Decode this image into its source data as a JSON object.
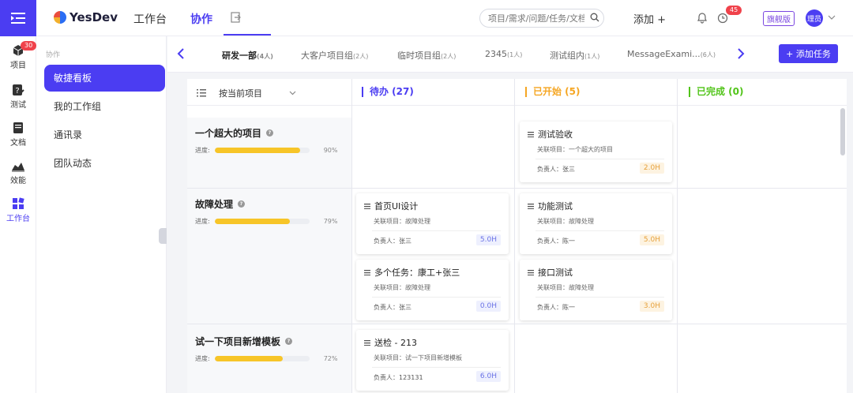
{
  "app": {
    "logo_text": "YesDev"
  },
  "topnav": {
    "items": [
      {
        "label": "工作台"
      },
      {
        "label": "协作"
      }
    ]
  },
  "search": {
    "placeholder": "项目/需求/问题/任务/文档"
  },
  "header": {
    "add_label": "添加 +",
    "notification_badge": "45",
    "plan_tag": "旗舰版",
    "avatar_text": "理员"
  },
  "rail": {
    "items": [
      {
        "label": "项目",
        "badge": "30"
      },
      {
        "label": "测试"
      },
      {
        "label": "文档"
      },
      {
        "label": "效能"
      },
      {
        "label": "工作台"
      }
    ]
  },
  "sidebar": {
    "section": "协作",
    "items": [
      {
        "label": "敏捷看板"
      },
      {
        "label": "我的工作组"
      },
      {
        "label": "通讯录"
      },
      {
        "label": "团队动态"
      }
    ]
  },
  "tabs": [
    {
      "label": "研发一部",
      "count": "(4人)"
    },
    {
      "label": "大客户项目组",
      "count": "(2人)"
    },
    {
      "label": "临时项目组",
      "count": "(2人)"
    },
    {
      "label": "2345",
      "count": "(1人)"
    },
    {
      "label": "测试组内",
      "count": "(1人)"
    },
    {
      "label": "MessageExami...",
      "count": "(6人)"
    }
  ],
  "add_task_label": "+ 添加任务",
  "board": {
    "filter_label": "按当前项目",
    "columns": [
      {
        "title": "待办 (27)",
        "color": "#4b3df2"
      },
      {
        "title": "已开始 (5)",
        "color": "#f5a623"
      },
      {
        "title": "已完成 (0)",
        "color": "#52c41a"
      }
    ],
    "projects": [
      {
        "name": "一个超大的项目",
        "progress_label": "进度:",
        "progress": 90,
        "pct": "90%"
      },
      {
        "name": "故障处理",
        "progress_label": "进度:",
        "progress": 79,
        "pct": "79%"
      },
      {
        "name": "试一下项目新增模板",
        "progress_label": "进度:",
        "progress": 72,
        "pct": "72%"
      }
    ],
    "cards": [
      {
        "title": "测试验收",
        "project": "关联项目：一个超大的项目",
        "owner": "负责人：张三",
        "hours": "2.0H",
        "hours_style": "orange"
      },
      {
        "title": "首页UI设计",
        "project": "关联项目：故障处理",
        "owner": "负责人：张三",
        "hours": "5.0H",
        "hours_style": "blue"
      },
      {
        "title": "功能测试",
        "project": "关联项目：故障处理",
        "owner": "负责人：陈一",
        "hours": "5.0H",
        "hours_style": "orange"
      },
      {
        "title": "多个任务：康工+张三",
        "project": "关联项目：故障处理",
        "owner": "负责人：张三",
        "hours": "0.0H",
        "hours_style": "blue"
      },
      {
        "title": "接口测试",
        "project": "关联项目：故障处理",
        "owner": "负责人：陈一",
        "hours": "3.0H",
        "hours_style": "orange"
      },
      {
        "title": "送检 - 213",
        "project": "关联项目：试一下项目新增模板",
        "owner": "负责人：123131",
        "hours": "6.0H",
        "hours_style": "blue"
      }
    ]
  }
}
